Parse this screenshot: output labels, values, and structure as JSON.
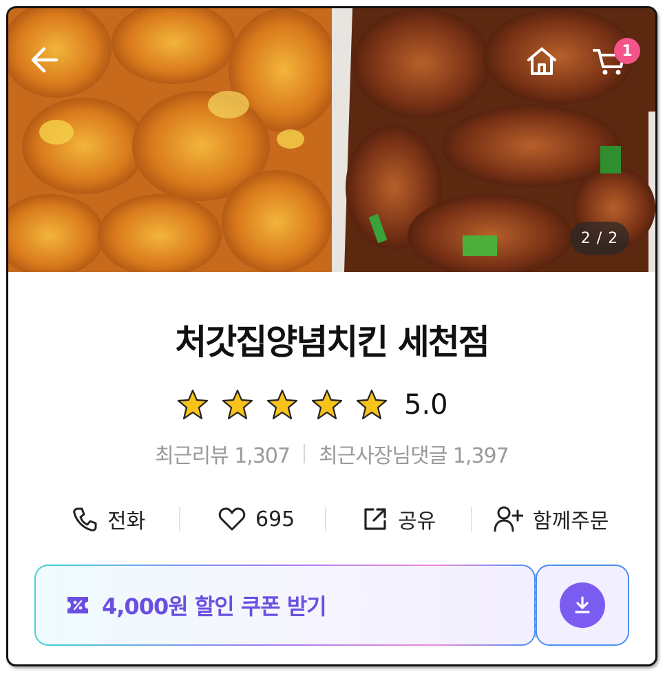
{
  "header": {
    "cart_count": "1",
    "photo_counter": "2 / 2"
  },
  "store": {
    "name": "처갓집양념치킨 세천점",
    "rating": "5.0",
    "star_count": 5,
    "recent_reviews_label": "최근리뷰 1,307",
    "owner_replies_label": "최근사장님댓글 1,397"
  },
  "actions": {
    "call_label": "전화",
    "like_count": "695",
    "share_label": "공유",
    "group_order_label": "함께주문"
  },
  "coupon": {
    "label": "4,000원 할인 쿠폰 받기"
  },
  "colors": {
    "accent": "#7b5cf0",
    "badge": "#f5548a",
    "star": "#f7c21a"
  },
  "icons": [
    "back-arrow-icon",
    "home-icon",
    "cart-icon",
    "star-icon",
    "phone-icon",
    "heart-icon",
    "share-icon",
    "add-person-icon",
    "coupon-icon",
    "download-icon"
  ]
}
